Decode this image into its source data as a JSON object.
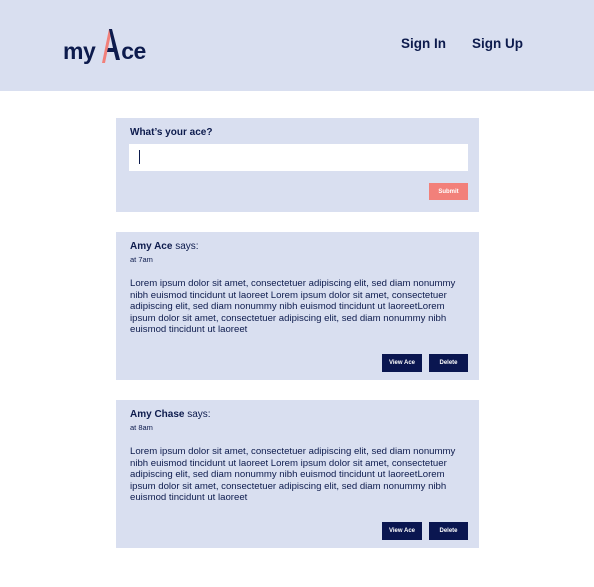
{
  "brand": {
    "logo_my": "my",
    "logo_ace": "Ace",
    "logo_accent_color": "#f2807a",
    "logo_color": "#0d1b4d"
  },
  "nav": {
    "sign_in": "Sign In",
    "sign_up": "Sign Up"
  },
  "compose": {
    "label": "What’s your ace?",
    "input_value": "",
    "input_placeholder": "",
    "submit_label": "Submit"
  },
  "posts": [
    {
      "author": "Amy Ace",
      "says": "says:",
      "time": "at 7am",
      "body": "Lorem ipsum dolor sit amet, consectetuer adipiscing elit, sed diam nonummy nibh euismod tincidunt ut laoreet Lorem ipsum dolor sit amet, consectetuer adipiscing elit, sed diam nonummy nibh euismod tincidunt ut laoreetLorem ipsum dolor sit amet, consectetuer adipiscing elit, sed diam nonummy nibh euismod tincidunt ut laoreet",
      "view_label": "View Ace",
      "delete_label": "Delete"
    },
    {
      "author": "Amy Chase",
      "says": "says:",
      "time": "at 8am",
      "body": "Lorem ipsum dolor sit amet, consectetuer adipiscing elit, sed diam nonummy nibh euismod tincidunt ut laoreet Lorem ipsum dolor sit amet, consectetuer adipiscing elit, sed diam nonummy nibh euismod tincidunt ut laoreetLorem ipsum dolor sit amet, consectetuer adipiscing elit, sed diam nonummy nibh euismod tincidunt ut laoreet",
      "view_label": "View Ace",
      "delete_label": "Delete"
    }
  ],
  "colors": {
    "panel_bg": "#d9dff0",
    "navy": "#0a1650",
    "coral": "#f2807a"
  }
}
